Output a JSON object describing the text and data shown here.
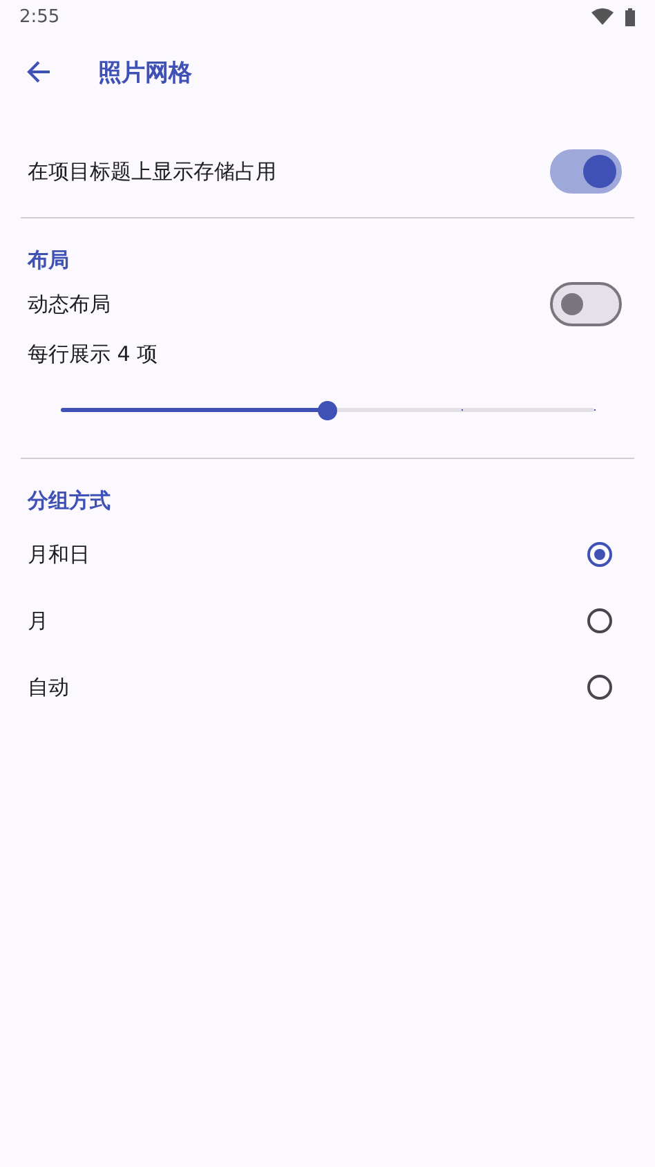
{
  "status_bar": {
    "time": "2:55"
  },
  "app_bar": {
    "title": "照片网格"
  },
  "storage_toggle": {
    "label": "在项目标题上显示存储占用",
    "on": true
  },
  "layout_section": {
    "title": "布局",
    "dynamic_toggle": {
      "label": "动态布局",
      "on": false
    },
    "slider": {
      "label": "每行展示 4 项",
      "level": 0.5
    }
  },
  "grouping_section": {
    "title": "分组方式",
    "options": [
      {
        "label": "月和日",
        "selected": true
      },
      {
        "label": "月",
        "selected": false
      },
      {
        "label": "自动",
        "selected": false
      }
    ]
  }
}
